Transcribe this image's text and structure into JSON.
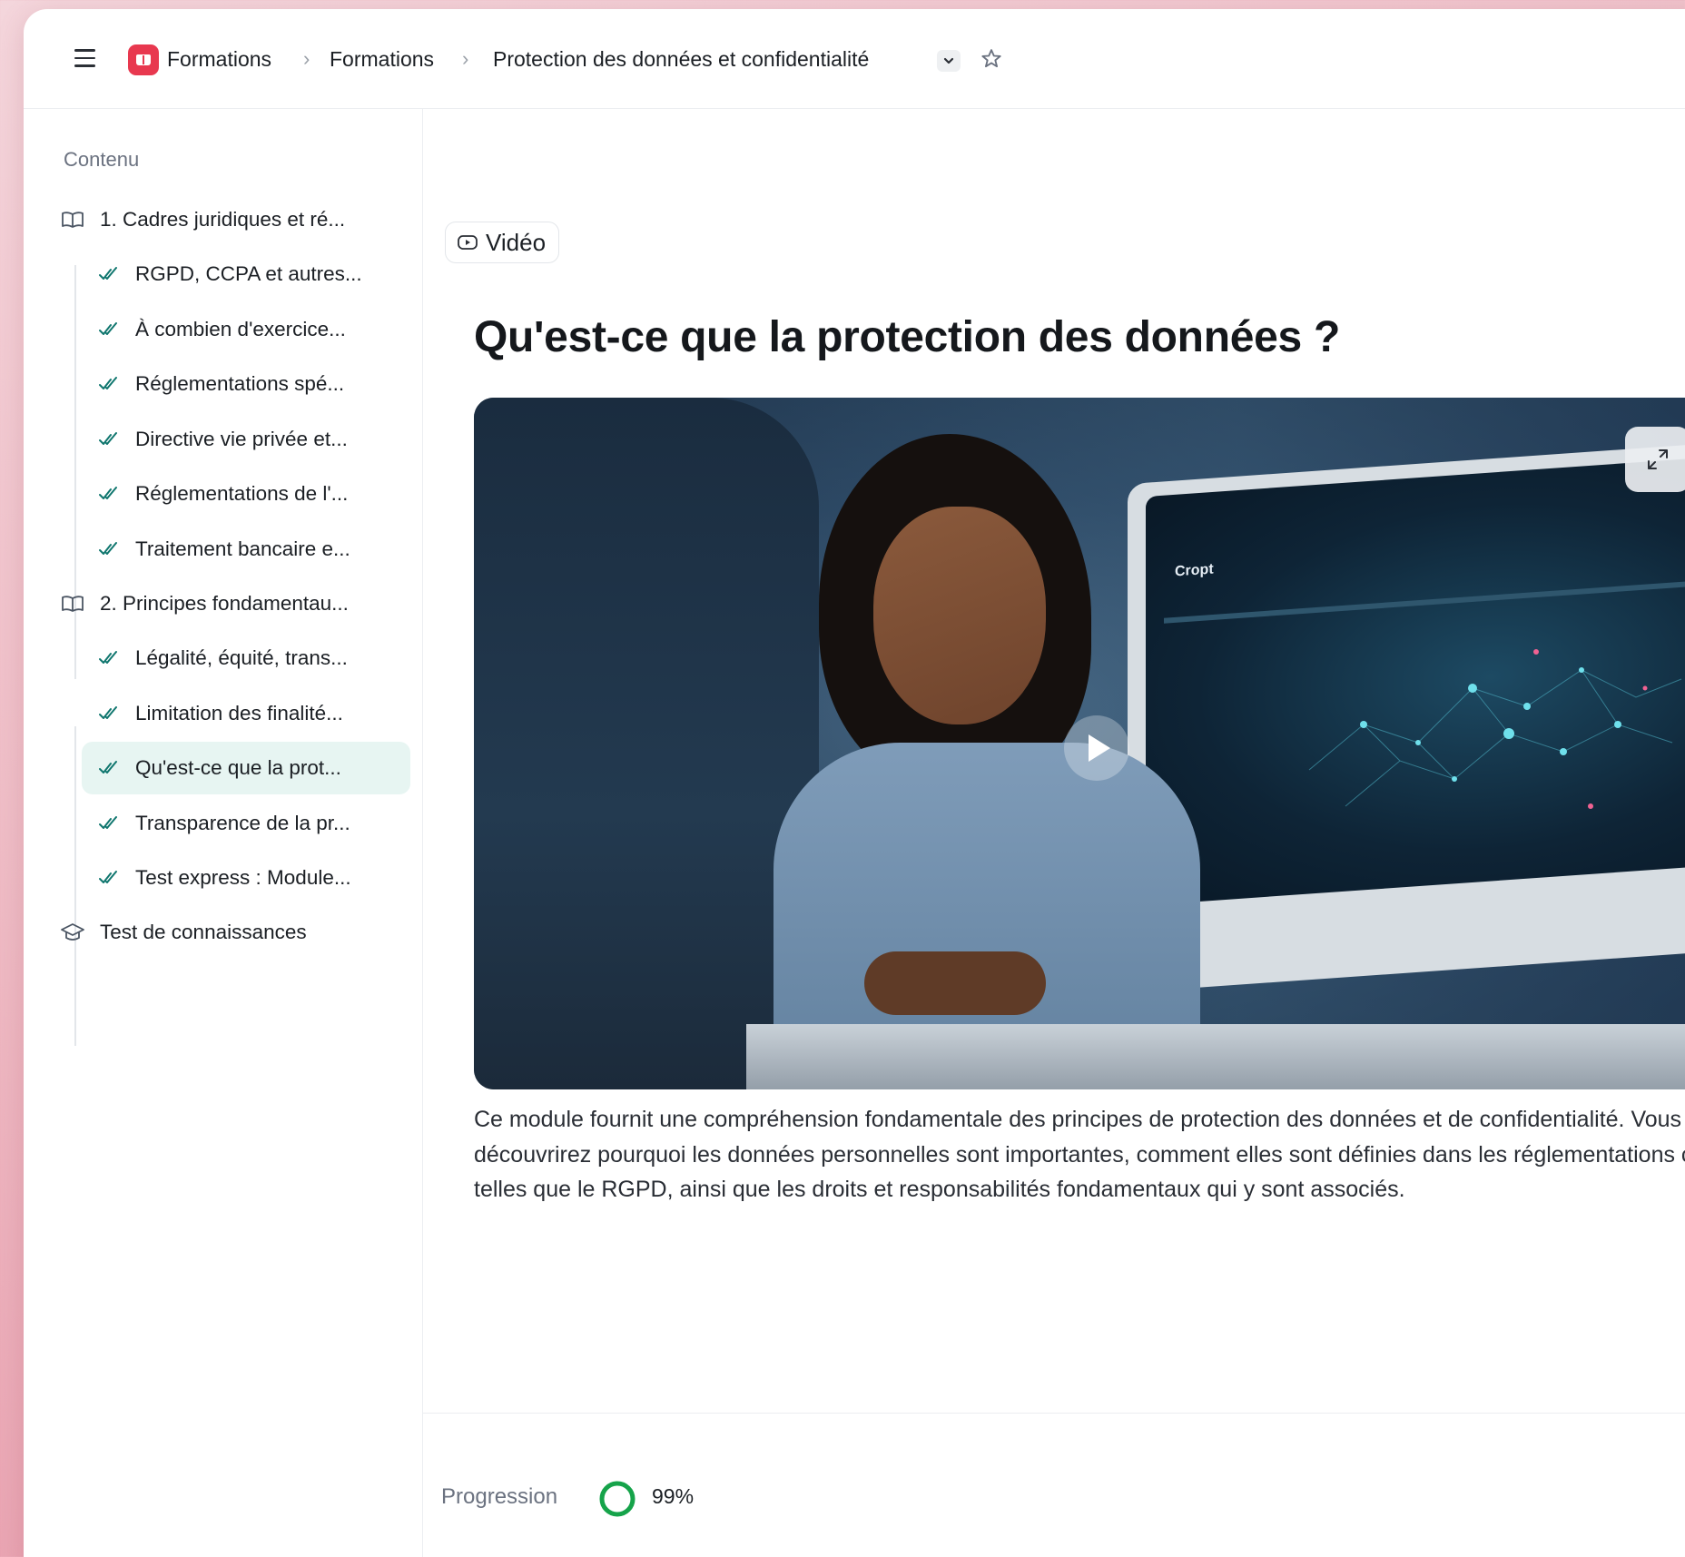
{
  "header": {
    "menu_icon": "hamburger-menu-icon",
    "app_icon": "book-icon",
    "breadcrumbs": [
      "Formations",
      "Formations",
      "Protection des données et confidentialité"
    ],
    "dropdown_icon": "chevron-down-icon",
    "favorite_icon": "star-icon"
  },
  "sidebar": {
    "title": "Contenu",
    "sections": [
      {
        "label": "1. Cadres juridiques et ré...",
        "icon": "book-open-icon",
        "items": [
          {
            "label": "RGPD, CCPA et autres...",
            "icon": "double-check-icon"
          },
          {
            "label": "À combien d'exercice...",
            "icon": "double-check-icon"
          },
          {
            "label": "Réglementations spé...",
            "icon": "double-check-icon"
          },
          {
            "label": "Directive vie privée et...",
            "icon": "double-check-icon"
          },
          {
            "label": "Réglementations de l'...",
            "icon": "double-check-icon"
          },
          {
            "label": "Traitement bancaire e...",
            "icon": "double-check-icon"
          }
        ]
      },
      {
        "label": "2. Principes fondamentau...",
        "icon": "book-open-icon",
        "items": [
          {
            "label": "Légalité, équité, trans...",
            "icon": "double-check-icon"
          },
          {
            "label": "Limitation des finalité...",
            "icon": "double-check-icon"
          },
          {
            "label": "Qu'est-ce que la prot...",
            "icon": "double-check-icon",
            "active": true
          },
          {
            "label": "Transparence de la pr...",
            "icon": "double-check-icon"
          },
          {
            "label": "Test express : Module...",
            "icon": "double-check-icon"
          }
        ]
      }
    ],
    "final": {
      "label": "Test de connaissances",
      "icon": "graduation-cap-icon"
    }
  },
  "main": {
    "type_badge": "Vidéo",
    "type_icon": "video-icon",
    "title": "Qu'est-ce que la protection des données ?",
    "video": {
      "screen_label": "Cropt",
      "play_icon": "play-icon",
      "expand_icon": "expand-icon"
    },
    "description": "Ce module fournit une compréhension fondamentale des principes de protection des données et de confidentialité. Vous découvrirez pourquoi les données personnelles sont importantes, comment elles sont définies dans les réglementations clés telles que le RGPD, ainsi que les droits et responsabilités fondamentaux qui y sont associés."
  },
  "footer": {
    "progress_label": "Progression",
    "progress_value": "99%",
    "progress_fraction": 0.99
  },
  "colors": {
    "accent": "#0f766e",
    "brand": "#e8384f",
    "progress": "#16a34a",
    "active_bg": "#e7f5f2"
  }
}
